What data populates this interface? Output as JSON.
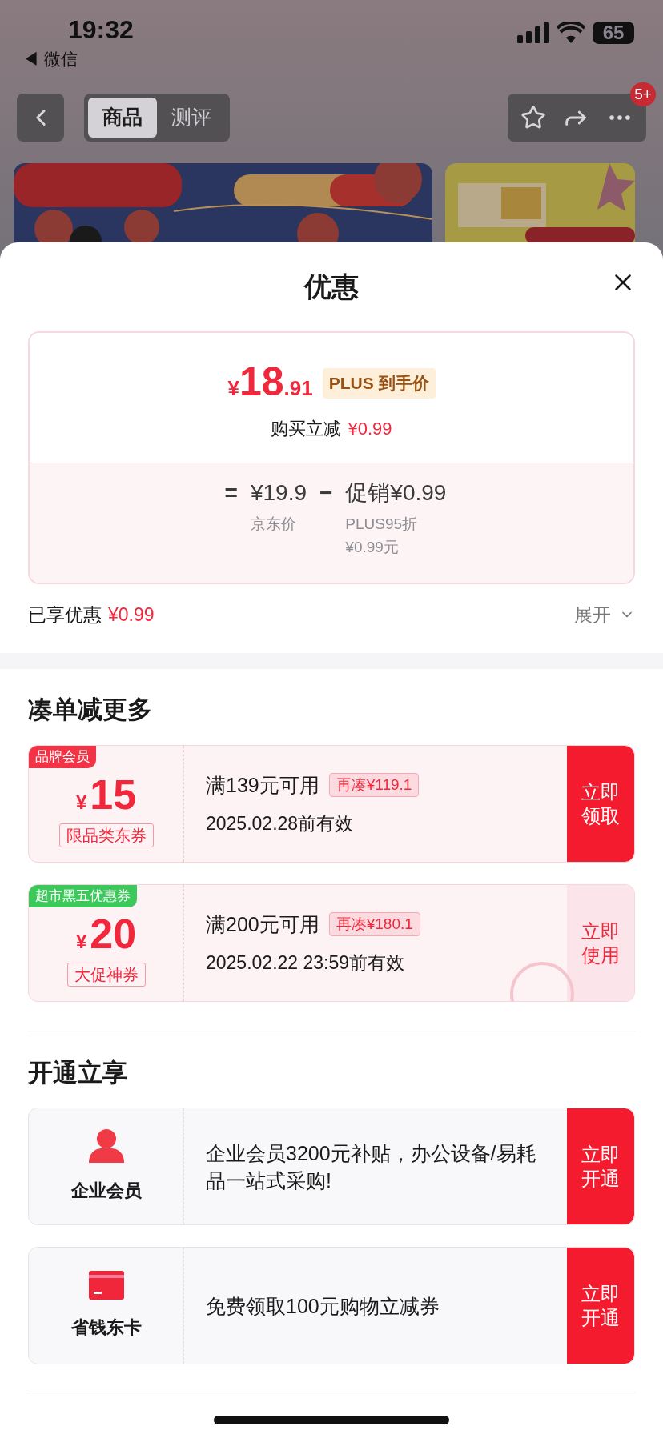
{
  "status_bar": {
    "time": "19:32",
    "back_app": "◀ 微信",
    "battery": "65"
  },
  "nav": {
    "tabs": [
      {
        "label": "商品",
        "selected": true
      },
      {
        "label": "测评",
        "selected": false
      }
    ],
    "badge": "5+"
  },
  "sheet": {
    "title": "优惠"
  },
  "price_card": {
    "price_symbol": "¥",
    "price_int": "18",
    "price_dec": ".91",
    "price_tag": "PLUS 到手价",
    "reduce_label": "购买立减",
    "reduce_value": "¥0.99",
    "equals": "=",
    "base_price": "¥19.9",
    "minus": "−",
    "promo": "促销¥0.99",
    "base_label": "京东价",
    "promo_note_1": "PLUS95折",
    "promo_note_2": "¥0.99元"
  },
  "enjoyed": {
    "label": "已享优惠",
    "value": "¥0.99",
    "expand": "展开"
  },
  "coupon_section": {
    "title": "凑单减更多",
    "coupons": [
      {
        "tag": "品牌会员",
        "color": "#f23346",
        "symbol": "¥",
        "amount": "15",
        "type": "限品类东券",
        "condition": "满139元可用",
        "gap": "再凑¥119.1",
        "validity": "2025.02.28前有效",
        "action": "立即领取",
        "claimed": false
      },
      {
        "tag": "超市黑五优惠券",
        "color": "#3cc85a",
        "symbol": "¥",
        "amount": "20",
        "type": "大促神券",
        "condition": "满200元可用",
        "gap": "再凑¥180.1",
        "validity": "2025.02.22 23:59前有效",
        "action": "立即使用",
        "claimed": true
      }
    ]
  },
  "services_section": {
    "title": "开通立享",
    "items": [
      {
        "kind": "member",
        "name": "企业会员",
        "description": "企业会员3200元补贴，办公设备/易耗品一站式采购!",
        "action": "立即开通"
      },
      {
        "kind": "card",
        "name": "省钱东卡",
        "description": "免费领取100元购物立减券",
        "action": "立即开通"
      }
    ]
  }
}
